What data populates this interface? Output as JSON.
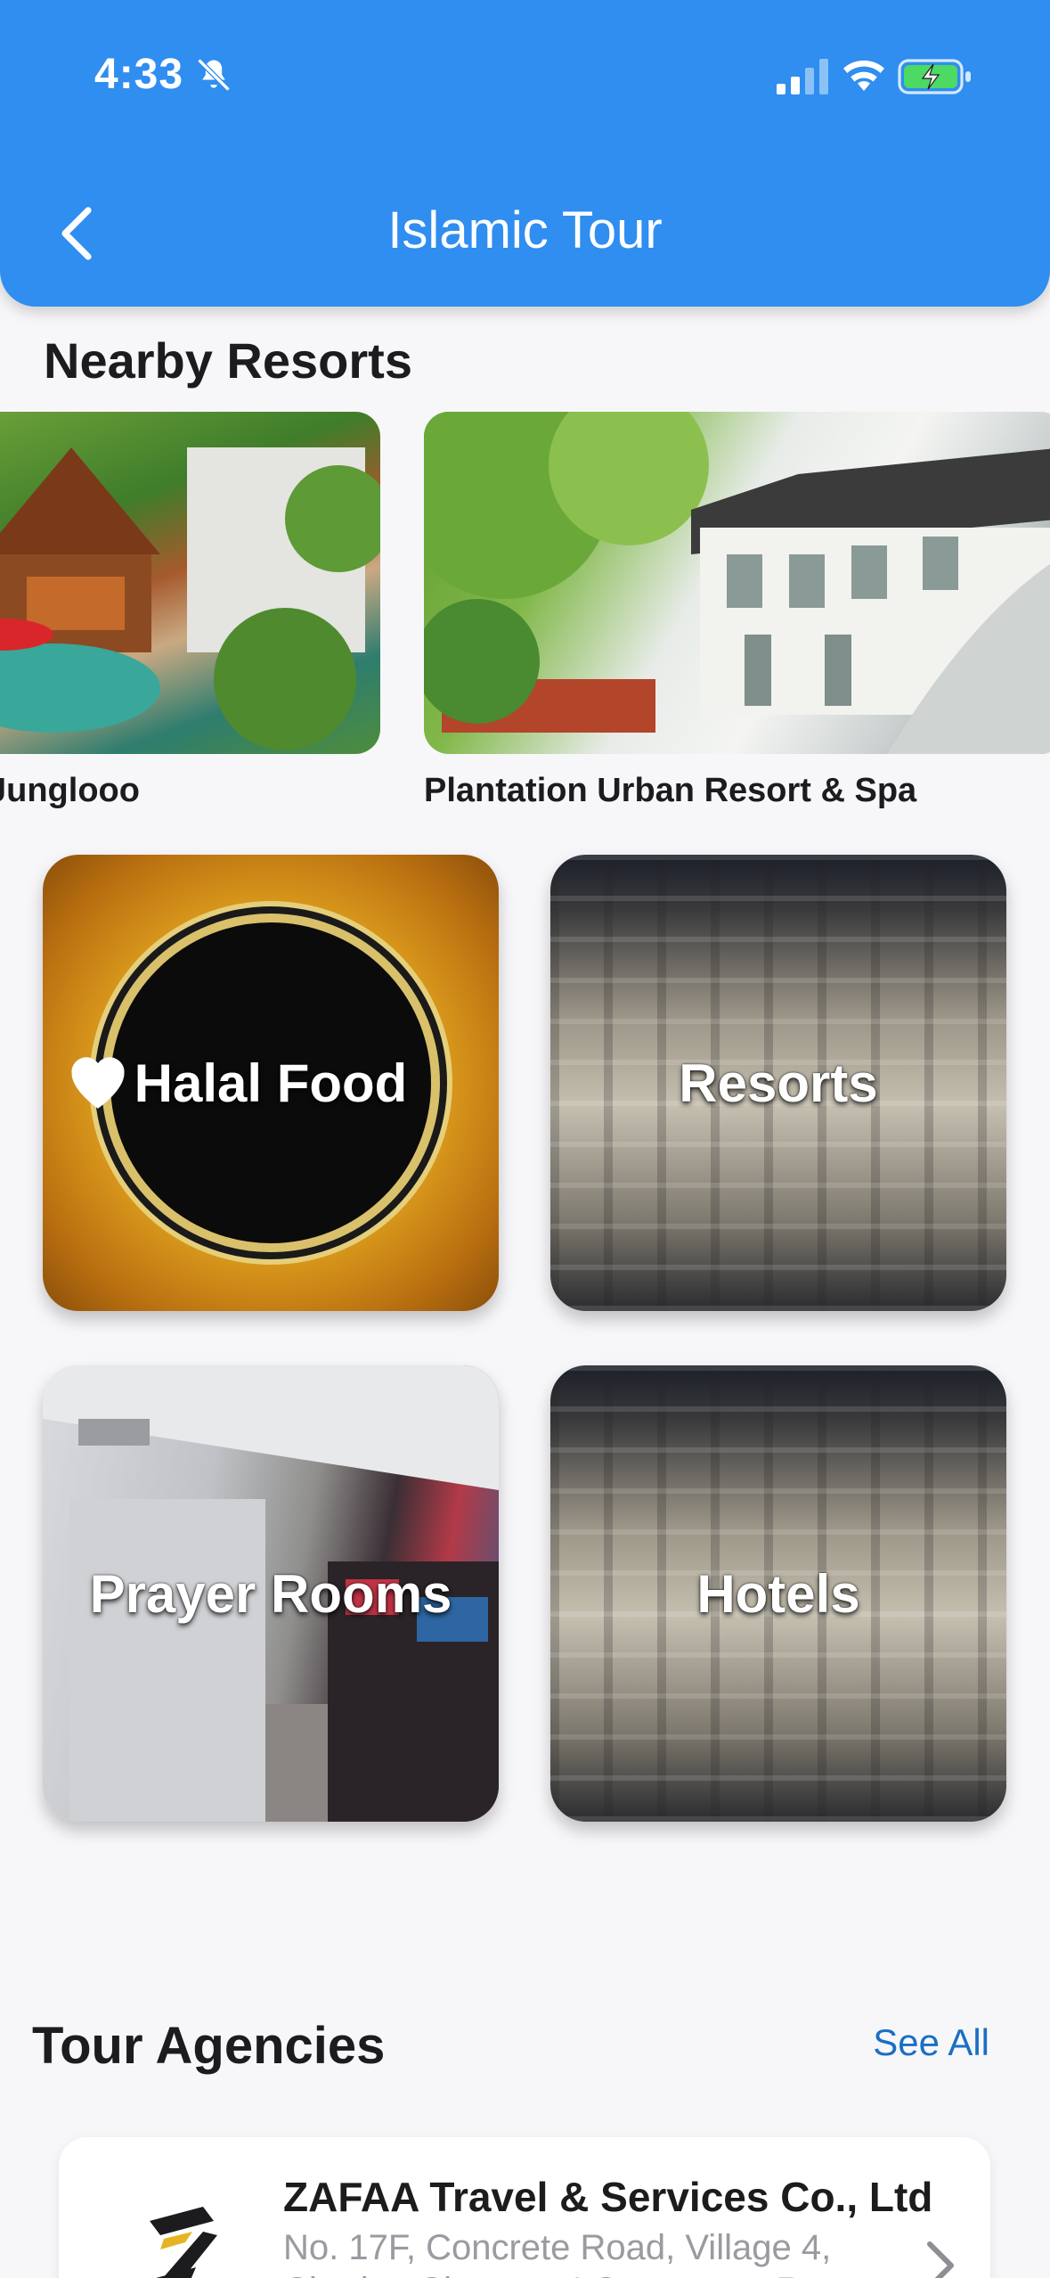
{
  "status_bar": {
    "time": "4:33",
    "icons": [
      "bell-slash-icon",
      "cellular-signal-icon",
      "wifi-icon",
      "battery-charging-icon"
    ]
  },
  "header": {
    "title": "Islamic Tour",
    "back_icon": "chevron-left-icon",
    "color": "#2f8ef0"
  },
  "nearby_resorts": {
    "title": "Nearby Resorts",
    "items": [
      {
        "name": "Junglooo"
      },
      {
        "name": "Plantation Urban Resort & Spa"
      }
    ]
  },
  "categories": [
    {
      "label": "Halal Food"
    },
    {
      "label": "Resorts"
    },
    {
      "label": "Prayer Rooms"
    },
    {
      "label": "Hotels"
    }
  ],
  "tour_agencies": {
    "title": "Tour Agencies",
    "see_all": "See All",
    "see_all_color": "#1a6fc4",
    "items": [
      {
        "name": "ZAFAA Travel & Services Co., Ltd",
        "address": "No. 17F, Concrete Road, Village 4, Chroing Chamres I Commune, Russey"
      }
    ]
  }
}
